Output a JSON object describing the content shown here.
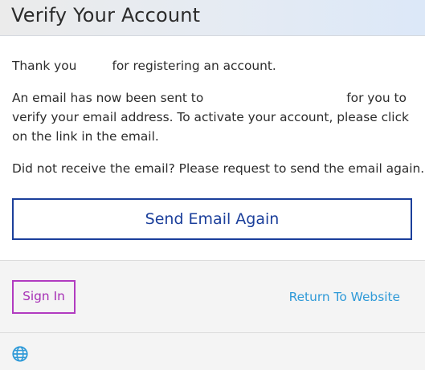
{
  "header": {
    "title": "Verify Your Account"
  },
  "body": {
    "thanks_prefix": "Thank you",
    "thanks_suffix": "for registering an account.",
    "email_sent_prefix": "An email has now been sent to",
    "email_sent_suffix": "for you to verify your email address. To activate your account, please click on the link in the email.",
    "not_received": "Did not receive the email? Please request to send the email again.",
    "send_again_label": "Send Email Again"
  },
  "footer": {
    "sign_in_label": "Sign In",
    "return_label": "Return To Website",
    "language_icon": "globe-icon"
  },
  "colors": {
    "primary_blue": "#1b3f9b",
    "link_blue": "#2f9ad8",
    "focus_purple": "#b13bc0"
  }
}
